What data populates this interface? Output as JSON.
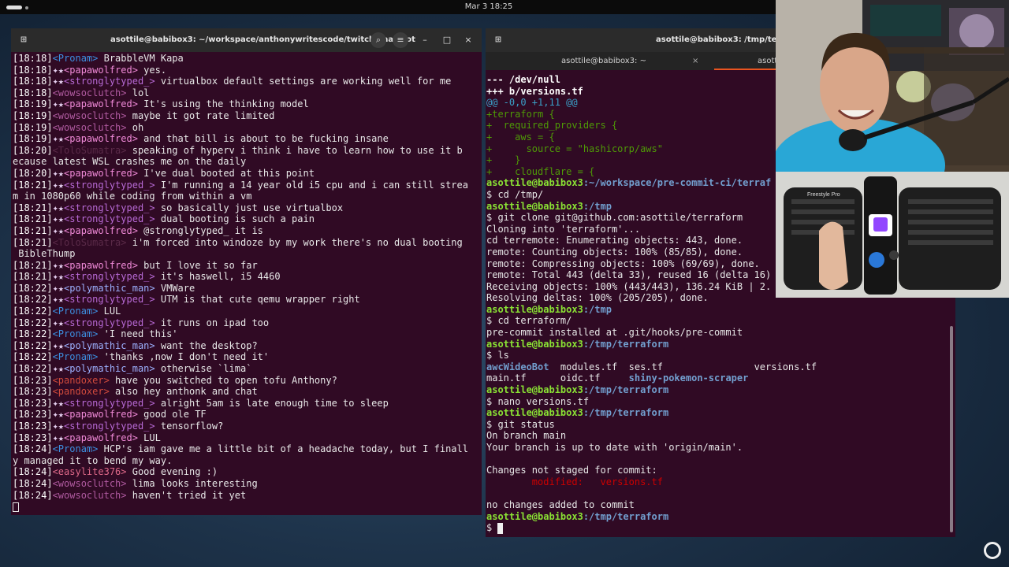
{
  "topbar": {
    "clock": "Mar 3  18:25"
  },
  "left_window": {
    "title": "asottile@babibox3: ~/workspace/anthonywritescode/twitch-chat-bot",
    "lines": [
      {
        "ts": "[18:18]",
        "badge": "",
        "user": "<Pronam>",
        "cls": "u-pronam",
        "msg": " BrabbleVM Kapa"
      },
      {
        "ts": "[18:18]",
        "badge": "✦★",
        "user": "<papawolfred>",
        "cls": "u-papa",
        "msg": " yes."
      },
      {
        "ts": "[18:18]",
        "badge": "✦★",
        "user": "<stronglytyped_>",
        "cls": "u-strong",
        "msg": " virtualbox default settings are working well for me"
      },
      {
        "ts": "[18:18]",
        "badge": "",
        "user": "<wowsoclutch>",
        "cls": "u-wowso",
        "msg": " lol"
      },
      {
        "ts": "[18:19]",
        "badge": "✦★",
        "user": "<papawolfred>",
        "cls": "u-papa",
        "msg": " It's using the thinking model"
      },
      {
        "ts": "[18:19]",
        "badge": "",
        "user": "<wowsoclutch>",
        "cls": "u-wowso",
        "msg": " maybe it got rate limited"
      },
      {
        "ts": "[18:19]",
        "badge": "",
        "user": "<wowsoclutch>",
        "cls": "u-wowso",
        "msg": " oh"
      },
      {
        "ts": "[18:19]",
        "badge": "✦★",
        "user": "<papawolfred>",
        "cls": "u-papa",
        "msg": " and that bill is about to be fucking insane"
      },
      {
        "ts": "[18:20]",
        "badge": "",
        "user": "<ToloSumatra>",
        "cls": "u-hidden",
        "msg": " speaking of hyperv i think i have to learn how to use it b"
      },
      {
        "ts": "",
        "badge": "",
        "user": "",
        "cls": "",
        "msg": "ecause latest WSL crashes me on the daily"
      },
      {
        "ts": "[18:20]",
        "badge": "✦★",
        "user": "<papawolfred>",
        "cls": "u-papa",
        "msg": " I've dual booted at this point"
      },
      {
        "ts": "[18:21]",
        "badge": "✦★",
        "user": "<stronglytyped_>",
        "cls": "u-strong",
        "msg": " I'm running a 14 year old i5 cpu and i can still strea"
      },
      {
        "ts": "",
        "badge": "",
        "user": "",
        "cls": "",
        "msg": "m in 1080p60 while coding from within a vm"
      },
      {
        "ts": "[18:21]",
        "badge": "✦★",
        "user": "<stronglytyped_>",
        "cls": "u-strong",
        "msg": " so basically just use virtualbox"
      },
      {
        "ts": "[18:21]",
        "badge": "✦★",
        "user": "<stronglytyped_>",
        "cls": "u-strong",
        "msg": " dual booting is such a pain"
      },
      {
        "ts": "[18:21]",
        "badge": "✦★",
        "user": "<papawolfred>",
        "cls": "u-papa",
        "msg": " @stronglytyped_ it is"
      },
      {
        "ts": "[18:21]",
        "badge": "",
        "user": "<ToloSumatra>",
        "cls": "u-hidden",
        "msg": " i'm forced into windoze by my work there's no dual booting"
      },
      {
        "ts": "",
        "badge": "",
        "user": "",
        "cls": "",
        "msg": " BibleThump"
      },
      {
        "ts": "[18:21]",
        "badge": "✦★",
        "user": "<papawolfred>",
        "cls": "u-papa",
        "msg": " but I love it so far"
      },
      {
        "ts": "[18:21]",
        "badge": "✦★",
        "user": "<stronglytyped_>",
        "cls": "u-strong",
        "msg": " it's haswell, i5 4460"
      },
      {
        "ts": "[18:22]",
        "badge": "✦★",
        "user": "<polymathic_man>",
        "cls": "u-poly",
        "msg": " VMWare"
      },
      {
        "ts": "[18:22]",
        "badge": "✦★",
        "user": "<stronglytyped_>",
        "cls": "u-strong",
        "msg": " UTM is that cute qemu wrapper right"
      },
      {
        "ts": "[18:22]",
        "badge": "",
        "user": "<Pronam>",
        "cls": "u-pronam",
        "msg": " LUL"
      },
      {
        "ts": "[18:22]",
        "badge": "✦★",
        "user": "<stronglytyped_>",
        "cls": "u-strong",
        "msg": " it runs on ipad too"
      },
      {
        "ts": "[18:22]",
        "badge": "",
        "user": "<Pronam>",
        "cls": "u-pronam",
        "msg": " 'I need this'"
      },
      {
        "ts": "[18:22]",
        "badge": "✦★",
        "user": "<polymathic_man>",
        "cls": "u-poly",
        "msg": " want the desktop?"
      },
      {
        "ts": "[18:22]",
        "badge": "",
        "user": "<Pronam>",
        "cls": "u-pronam",
        "msg": " 'thanks ,now I don't need it'"
      },
      {
        "ts": "[18:22]",
        "badge": "✦★",
        "user": "<polymathic_man>",
        "cls": "u-poly",
        "msg": " otherwise `lima`"
      },
      {
        "ts": "[18:23]",
        "badge": "",
        "user": "<pandoxer>",
        "cls": "u-pando",
        "msg": " have you switched to open tofu Anthony?"
      },
      {
        "ts": "[18:23]",
        "badge": "",
        "user": "<pandoxer>",
        "cls": "u-pando",
        "msg": " also hey anthonk and chat"
      },
      {
        "ts": "[18:23]",
        "badge": "✦★",
        "user": "<stronglytyped_>",
        "cls": "u-strong",
        "msg": " alright 5am is late enough time to sleep"
      },
      {
        "ts": "[18:23]",
        "badge": "✦★",
        "user": "<papawolfred>",
        "cls": "u-papa",
        "msg": " good ole TF"
      },
      {
        "ts": "[18:23]",
        "badge": "✦★",
        "user": "<stronglytyped_>",
        "cls": "u-strong",
        "msg": " tensorflow?"
      },
      {
        "ts": "[18:23]",
        "badge": "✦★",
        "user": "<papawolfred>",
        "cls": "u-papa",
        "msg": " LUL"
      },
      {
        "ts": "[18:24]",
        "badge": "",
        "user": "<Pronam>",
        "cls": "u-pronam",
        "msg": " HCP's iam gave me a little bit of a headache today, but I finall"
      },
      {
        "ts": "",
        "badge": "",
        "user": "",
        "cls": "",
        "msg": "y managed it to bend my way."
      },
      {
        "ts": "[18:24]",
        "badge": "",
        "user": "<easylite376>",
        "cls": "u-easy",
        "msg": " Good evening :)"
      },
      {
        "ts": "[18:24]",
        "badge": "",
        "user": "<wowsoclutch>",
        "cls": "u-wowso",
        "msg": " lima looks interesting"
      },
      {
        "ts": "[18:24]",
        "badge": "",
        "user": "<wowsoclutch>",
        "cls": "u-wowso",
        "msg": " haven't tried it yet"
      }
    ]
  },
  "right_window": {
    "title": "asottile@babibox3: /tmp/terrafor",
    "tab1_label": "asottile@babibox3: ~",
    "tab2_label": "asotti",
    "lines": [
      {
        "segs": [
          {
            "t": "--- /dev/null",
            "c": "diff-h"
          }
        ]
      },
      {
        "segs": [
          {
            "t": "+++ b/versions.tf",
            "c": "diff-h"
          }
        ]
      },
      {
        "segs": [
          {
            "t": "@@ -0,0 +1,11 @@",
            "c": "diff-at"
          }
        ]
      },
      {
        "segs": [
          {
            "t": "+terraform {",
            "c": "diff-add"
          }
        ]
      },
      {
        "segs": [
          {
            "t": "+  required_providers {",
            "c": "diff-add"
          }
        ]
      },
      {
        "segs": [
          {
            "t": "+    aws = {",
            "c": "diff-add"
          }
        ]
      },
      {
        "segs": [
          {
            "t": "+      source = \"hashicorp/aws\"",
            "c": "diff-add"
          }
        ]
      },
      {
        "segs": [
          {
            "t": "+    }",
            "c": "diff-add"
          }
        ]
      },
      {
        "segs": [
          {
            "t": "+    cloudflare = {",
            "c": "diff-add"
          }
        ]
      },
      {
        "segs": [
          {
            "t": "asottile@babibox3",
            "c": "prompt-user"
          },
          {
            "t": ":~/workspace/pre-commit-ci/terraf",
            "c": "prompt-path"
          }
        ]
      },
      {
        "segs": [
          {
            "t": "$ cd /tmp/",
            "c": ""
          }
        ]
      },
      {
        "segs": [
          {
            "t": "asottile@babibox3",
            "c": "prompt-user"
          },
          {
            "t": ":/tmp",
            "c": "prompt-path"
          }
        ]
      },
      {
        "segs": [
          {
            "t": "$ git clone git@github.com:asottile/terraform",
            "c": ""
          }
        ]
      },
      {
        "segs": [
          {
            "t": "Cloning into 'terraform'...",
            "c": ""
          }
        ]
      },
      {
        "segs": [
          {
            "t": "cd terremote: Enumerating objects: 443, done.",
            "c": ""
          }
        ]
      },
      {
        "segs": [
          {
            "t": "remote: Counting objects: 100% (85/85), done.",
            "c": ""
          }
        ]
      },
      {
        "segs": [
          {
            "t": "remote: Compressing objects: 100% (69/69), done.",
            "c": ""
          }
        ]
      },
      {
        "segs": [
          {
            "t": "remote: Total 443 (delta 33), reused 16 (delta 16)",
            "c": ""
          }
        ]
      },
      {
        "segs": [
          {
            "t": "Receiving objects: 100% (443/443), 136.24 KiB | 2.",
            "c": ""
          }
        ]
      },
      {
        "segs": [
          {
            "t": "Resolving deltas: 100% (205/205), done.",
            "c": ""
          }
        ]
      },
      {
        "segs": [
          {
            "t": "asottile@babibox3",
            "c": "prompt-user"
          },
          {
            "t": ":/tmp",
            "c": "prompt-path"
          }
        ]
      },
      {
        "segs": [
          {
            "t": "$ cd terraform/",
            "c": ""
          }
        ]
      },
      {
        "segs": [
          {
            "t": "pre-commit installed at .git/hooks/pre-commit",
            "c": ""
          }
        ]
      },
      {
        "segs": [
          {
            "t": "asottile@babibox3",
            "c": "prompt-user"
          },
          {
            "t": ":/tmp/terraform",
            "c": "prompt-path"
          }
        ]
      },
      {
        "segs": [
          {
            "t": "$ ls",
            "c": ""
          }
        ]
      },
      {
        "segs": [
          {
            "t": "awcWideoBot",
            "c": "ls-dir"
          },
          {
            "t": "  modules.tf  ses.tf                versions.tf",
            "c": ""
          }
        ]
      },
      {
        "segs": [
          {
            "t": "main.tf      oidc.tf     ",
            "c": ""
          },
          {
            "t": "shiny-pokemon-scraper",
            "c": "ls-dir"
          }
        ]
      },
      {
        "segs": [
          {
            "t": "asottile@babibox3",
            "c": "prompt-user"
          },
          {
            "t": ":/tmp/terraform",
            "c": "prompt-path"
          }
        ]
      },
      {
        "segs": [
          {
            "t": "$ nano versions.tf",
            "c": ""
          }
        ]
      },
      {
        "segs": [
          {
            "t": "asottile@babibox3",
            "c": "prompt-user"
          },
          {
            "t": ":/tmp/terraform",
            "c": "prompt-path"
          }
        ]
      },
      {
        "segs": [
          {
            "t": "$ git status",
            "c": ""
          }
        ]
      },
      {
        "segs": [
          {
            "t": "On branch main",
            "c": ""
          }
        ]
      },
      {
        "segs": [
          {
            "t": "Your branch is up to date with 'origin/main'.",
            "c": ""
          }
        ]
      },
      {
        "segs": [
          {
            "t": "",
            "c": ""
          }
        ]
      },
      {
        "segs": [
          {
            "t": "Changes not staged for commit:",
            "c": ""
          }
        ]
      },
      {
        "segs": [
          {
            "t": "        modified:   versions.tf",
            "c": "mod-red"
          }
        ]
      },
      {
        "segs": [
          {
            "t": "",
            "c": ""
          }
        ]
      },
      {
        "segs": [
          {
            "t": "no changes added to commit",
            "c": ""
          }
        ]
      },
      {
        "segs": [
          {
            "t": "asottile@babibox3",
            "c": "prompt-user"
          },
          {
            "t": ":/tmp/terraform",
            "c": "prompt-path"
          }
        ]
      },
      {
        "segs": [
          {
            "t": "$ ",
            "c": ""
          }
        ]
      }
    ]
  },
  "overlay": {
    "keyboard_brand": "Freestyle Pro"
  }
}
